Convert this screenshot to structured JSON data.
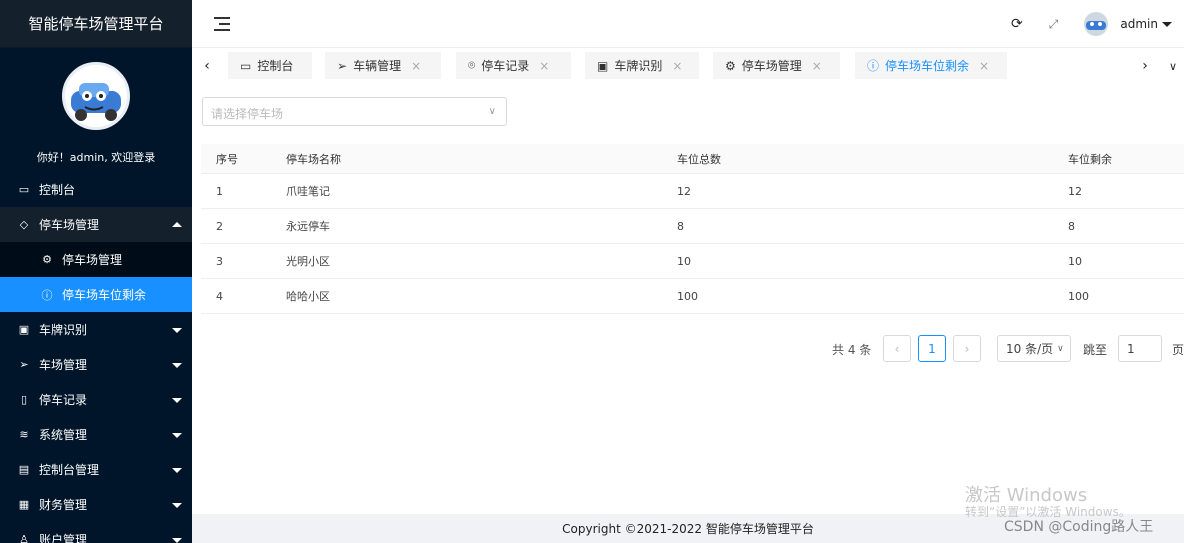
{
  "brand": {
    "title": "智能停车场管理平台"
  },
  "welcome": "你好！admin, 欢迎登录",
  "menu": {
    "dashboard": "控制台",
    "parking_mgmt": "停车场管理",
    "sub_parking_mgmt": "停车场管理",
    "sub_parking_remain": "停车场车位剩余",
    "plate_recognition": "车牌识别",
    "lot_mgmt": "车场管理",
    "parking_records": "停车记录",
    "system_mgmt": "系统管理",
    "console_mgmt": "控制台管理",
    "finance_mgmt": "财务管理",
    "account_mgmt": "账户管理"
  },
  "header": {
    "username": "admin"
  },
  "tabs": [
    {
      "label": "控制台"
    },
    {
      "label": "车辆管理"
    },
    {
      "label": "停车记录"
    },
    {
      "label": "车牌识别"
    },
    {
      "label": "停车场管理"
    },
    {
      "label": "停车场车位剩余"
    }
  ],
  "select": {
    "placeholder": "请选择停车场"
  },
  "table": {
    "headers": [
      "序号",
      "停车场名称",
      "车位总数",
      "车位剩余"
    ],
    "rows": [
      [
        "1",
        "爪哇笔记",
        "12",
        "12"
      ],
      [
        "2",
        "永远停车",
        "8",
        "8"
      ],
      [
        "3",
        "光明小区",
        "10",
        "10"
      ],
      [
        "4",
        "哈哈小区",
        "100",
        "100"
      ]
    ]
  },
  "pagination": {
    "total": "共 4 条",
    "current": "1",
    "page_size": "10 条/页",
    "jump_label": "跳至",
    "jump_value": "1",
    "page_label": "页"
  },
  "footer": "Copyright ©2021-2022 智能停车场管理平台",
  "watermark": {
    "line1": "激活 Windows",
    "line2": "转到“设置”以激活 Windows。",
    "csdn": "CSDN @Coding路人王"
  },
  "colors": {
    "sidebar": "#001529",
    "active": "#1890ff"
  }
}
